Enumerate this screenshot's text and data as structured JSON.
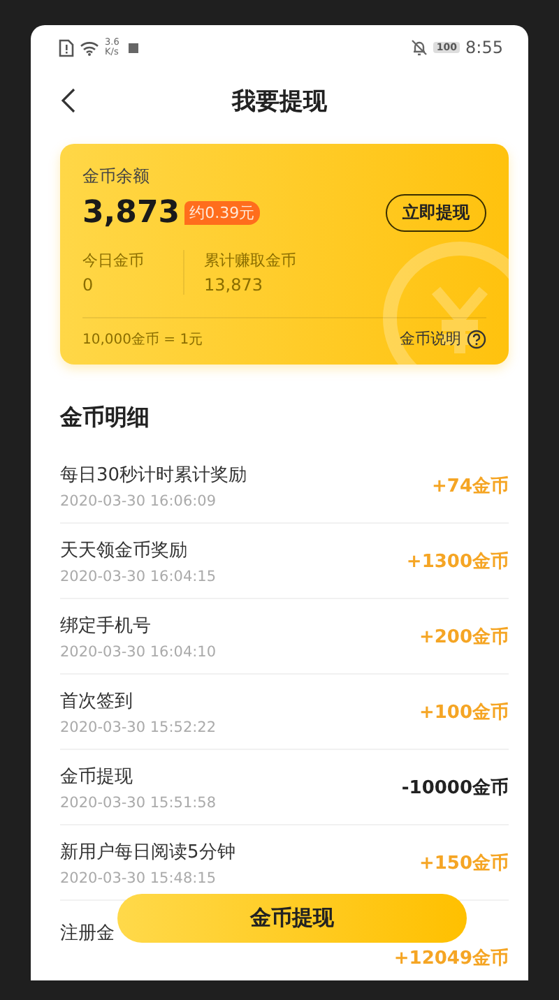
{
  "status_bar": {
    "network_speed": "3.6",
    "speed_unit": "K/s",
    "battery": "100",
    "time": "8:55"
  },
  "header": {
    "title": "我要提现"
  },
  "balance_card": {
    "label": "金币余额",
    "amount": "3,873",
    "cash_badge": "约0.39元",
    "withdraw_button": "立即提现",
    "stats": [
      {
        "label": "今日金币",
        "value": "0"
      },
      {
        "label": "累计赚取金币",
        "value": "13,873"
      }
    ],
    "rate": "10,000金币 = 1元",
    "help_link": "金币说明"
  },
  "section_title": "金币明细",
  "records": [
    {
      "title": "每日30秒计时累计奖励",
      "time": "2020-03-30 16:06:09",
      "amount": "+74金币",
      "kind": "income"
    },
    {
      "title": "天天领金币奖励",
      "time": "2020-03-30 16:04:15",
      "amount": "+1300金币",
      "kind": "income"
    },
    {
      "title": "绑定手机号",
      "time": "2020-03-30 16:04:10",
      "amount": "+200金币",
      "kind": "income"
    },
    {
      "title": "首次签到",
      "time": "2020-03-30 15:52:22",
      "amount": "+100金币",
      "kind": "income"
    },
    {
      "title": "金币提现",
      "time": "2020-03-30 15:51:58",
      "amount": "-10000金币",
      "kind": "expense"
    },
    {
      "title": "新用户每日阅读5分钟",
      "time": "2020-03-30 15:48:15",
      "amount": "+150金币",
      "kind": "income"
    },
    {
      "title": "注册金",
      "amount": "+12049金币",
      "kind": "income"
    }
  ],
  "bottom_button": "金币提现"
}
